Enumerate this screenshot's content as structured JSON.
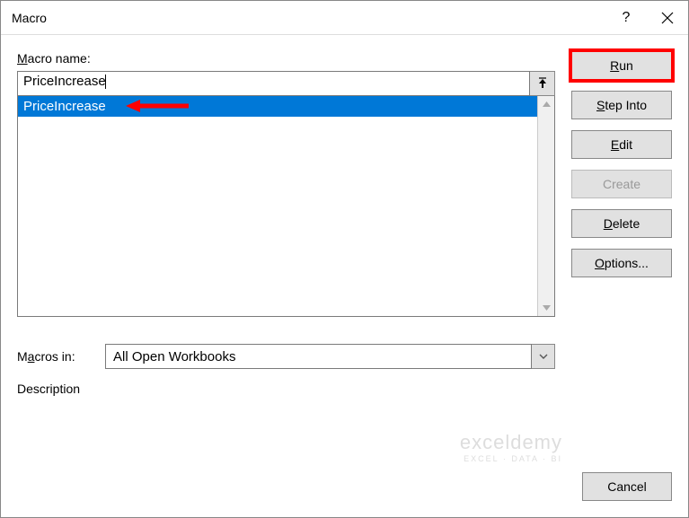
{
  "titlebar": {
    "title": "Macro",
    "help": "?",
    "close": "✕"
  },
  "labels": {
    "macro_name": "Macro name:",
    "macros_in": "Macros in:",
    "description": "Description"
  },
  "macro_name_input": "PriceIncrease",
  "macro_list": [
    {
      "name": "PriceIncrease",
      "selected": true
    }
  ],
  "macros_in_value": "All Open Workbooks",
  "buttons": {
    "run": "Run",
    "step_into": "Step Into",
    "edit": "Edit",
    "create": "Create",
    "delete": "Delete",
    "options": "Options...",
    "cancel": "Cancel"
  },
  "watermark": {
    "title": "exceldemy",
    "sub": "EXCEL · DATA · BI"
  }
}
